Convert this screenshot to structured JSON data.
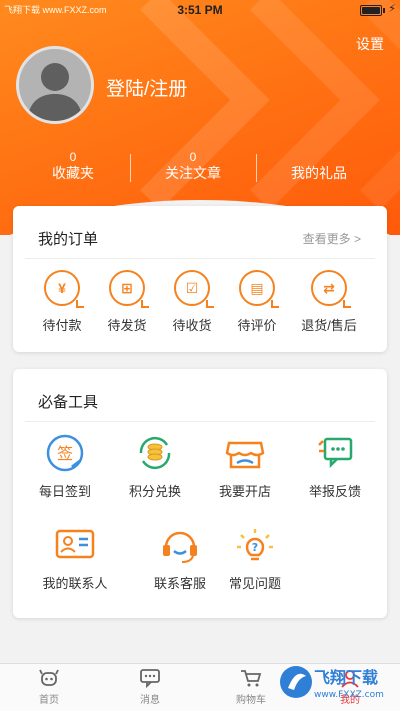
{
  "status_bar": {
    "carrier": "飞翔下载 www.FXXZ.com",
    "time": "3:51 PM"
  },
  "header": {
    "settings_label": "设置",
    "login_label": "登陆/注册"
  },
  "stats": [
    {
      "count": "0",
      "label": "收藏夹"
    },
    {
      "count": "0",
      "label": "关注文章"
    },
    {
      "label": "我的礼品"
    }
  ],
  "orders": {
    "title": "我的订单",
    "more_label": "查看更多 >",
    "items": [
      {
        "label": "待付款",
        "icon": "yen-icon",
        "glyph": "¥"
      },
      {
        "label": "待发货",
        "icon": "package-icon",
        "glyph": "⊞"
      },
      {
        "label": "待收货",
        "icon": "checkbox-icon",
        "glyph": "☑"
      },
      {
        "label": "待评价",
        "icon": "comment-icon",
        "glyph": "▤"
      },
      {
        "label": "退货/售后",
        "icon": "exchange-icon",
        "glyph": "⇄"
      }
    ]
  },
  "tools": {
    "title": "必备工具",
    "items": [
      {
        "label": "每日签到",
        "icon": "sign-in-icon",
        "glyph": "签"
      },
      {
        "label": "积分兑换",
        "icon": "coins-exchange-icon"
      },
      {
        "label": "我要开店",
        "icon": "shop-icon"
      },
      {
        "label": "举报反馈",
        "icon": "feedback-icon"
      },
      {
        "label": "我的联系人",
        "icon": "contact-card-icon"
      },
      {
        "label": "联系客服",
        "icon": "headset-icon"
      },
      {
        "label": "常见问题",
        "icon": "question-bulb-icon"
      }
    ]
  },
  "tabbar": {
    "items": [
      {
        "label": "首页",
        "icon": "home-icon"
      },
      {
        "label": "消息",
        "icon": "message-icon"
      },
      {
        "label": "购物车",
        "icon": "cart-icon"
      },
      {
        "label": "我的",
        "icon": "profile-icon",
        "active": true
      }
    ]
  },
  "watermark": {
    "text": "飞翔下载",
    "url": "www.FXXZ.com"
  },
  "colors": {
    "accent": "#f6821f",
    "header_start": "#ff8a1e",
    "header_end": "#ff5a0a",
    "active_tab": "#e4393c"
  }
}
